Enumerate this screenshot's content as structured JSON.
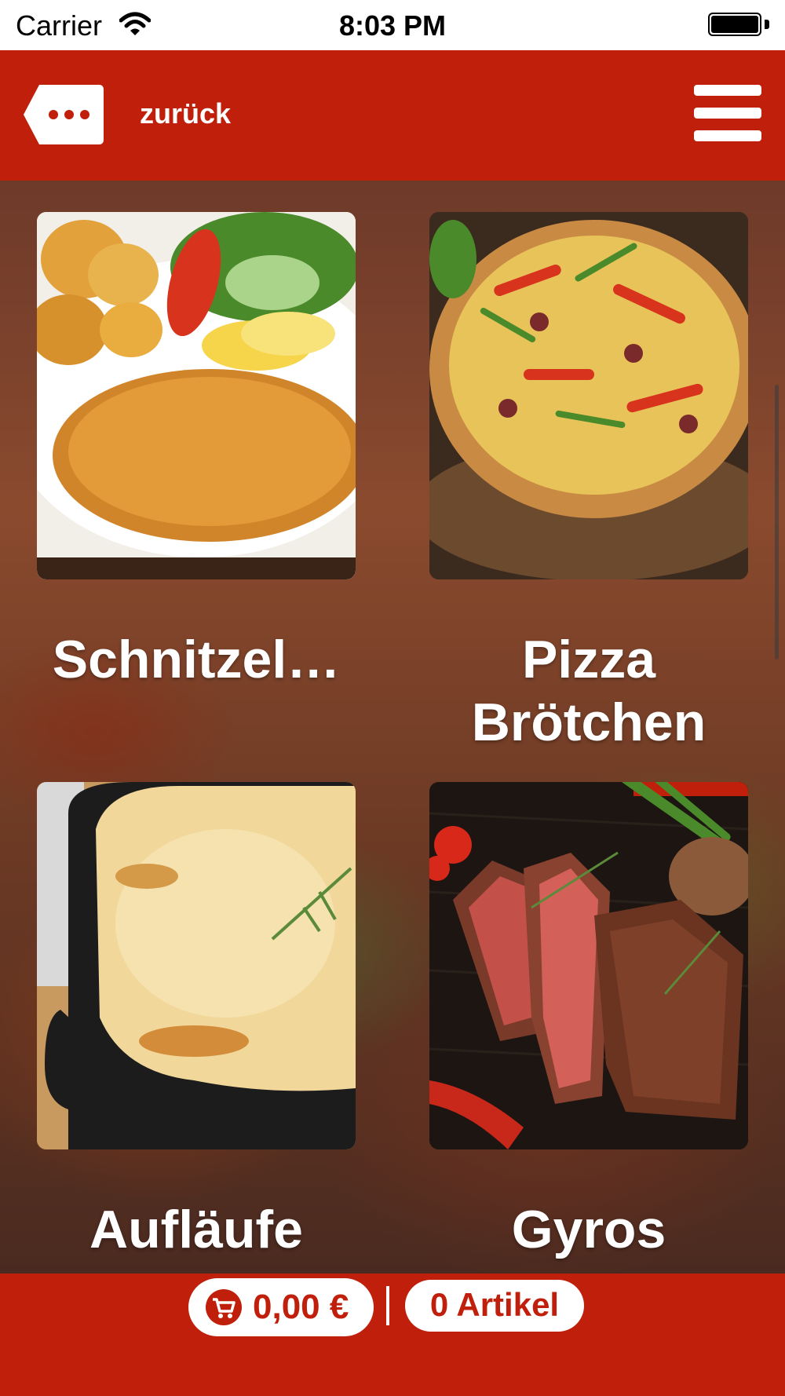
{
  "status_bar": {
    "carrier": "Carrier",
    "time": "8:03 PM"
  },
  "header": {
    "back_label": "zurück"
  },
  "categories": [
    {
      "title": "Schnitzel…",
      "image": "schnitzel-photo"
    },
    {
      "title": "Pizza Brötchen",
      "image": "pizza-photo"
    },
    {
      "title": "Aufläufe",
      "image": "casserole-photo"
    },
    {
      "title": "Gyros",
      "image": "steak-photo"
    }
  ],
  "cart": {
    "price": "0,00 €",
    "items": "0 Artikel"
  },
  "colors": {
    "brand_red": "#c0200b",
    "white": "#ffffff"
  }
}
